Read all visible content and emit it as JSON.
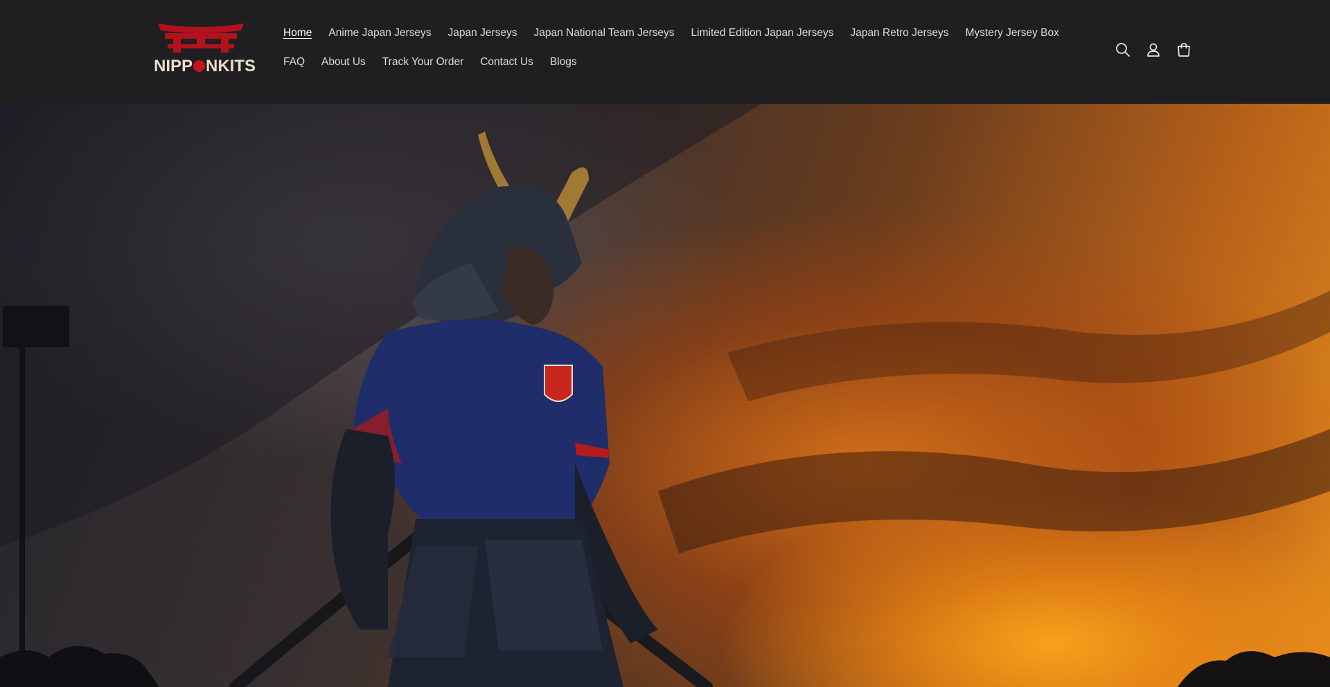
{
  "brand": {
    "logo_text": "NIPPONKITS",
    "logo_text_before_dot": "NIPP",
    "logo_text_after_dot": "NKITS",
    "logo_colors": {
      "torii": "#b3121c",
      "text": "#e9dfc9"
    }
  },
  "nav": {
    "row1": [
      {
        "label": "Home",
        "active": true
      },
      {
        "label": "Anime Japan Jerseys"
      },
      {
        "label": "Japan Jerseys"
      },
      {
        "label": "Japan National Team Jerseys"
      },
      {
        "label": "Limited Edition Japan Jerseys"
      },
      {
        "label": "Japan Retro Jerseys"
      },
      {
        "label": "Mystery Jersey Box"
      }
    ],
    "row2": [
      {
        "label": "FAQ"
      },
      {
        "label": "About Us"
      },
      {
        "label": "Track Your Order"
      },
      {
        "label": "Contact Us"
      },
      {
        "label": "Blogs"
      }
    ]
  },
  "header_icons": [
    "search-icon",
    "account-icon",
    "cart-icon"
  ],
  "colors": {
    "header_bg": "#1f1f22",
    "accent_red": "#c4141c",
    "sunset_orange": "#e48c1c"
  }
}
